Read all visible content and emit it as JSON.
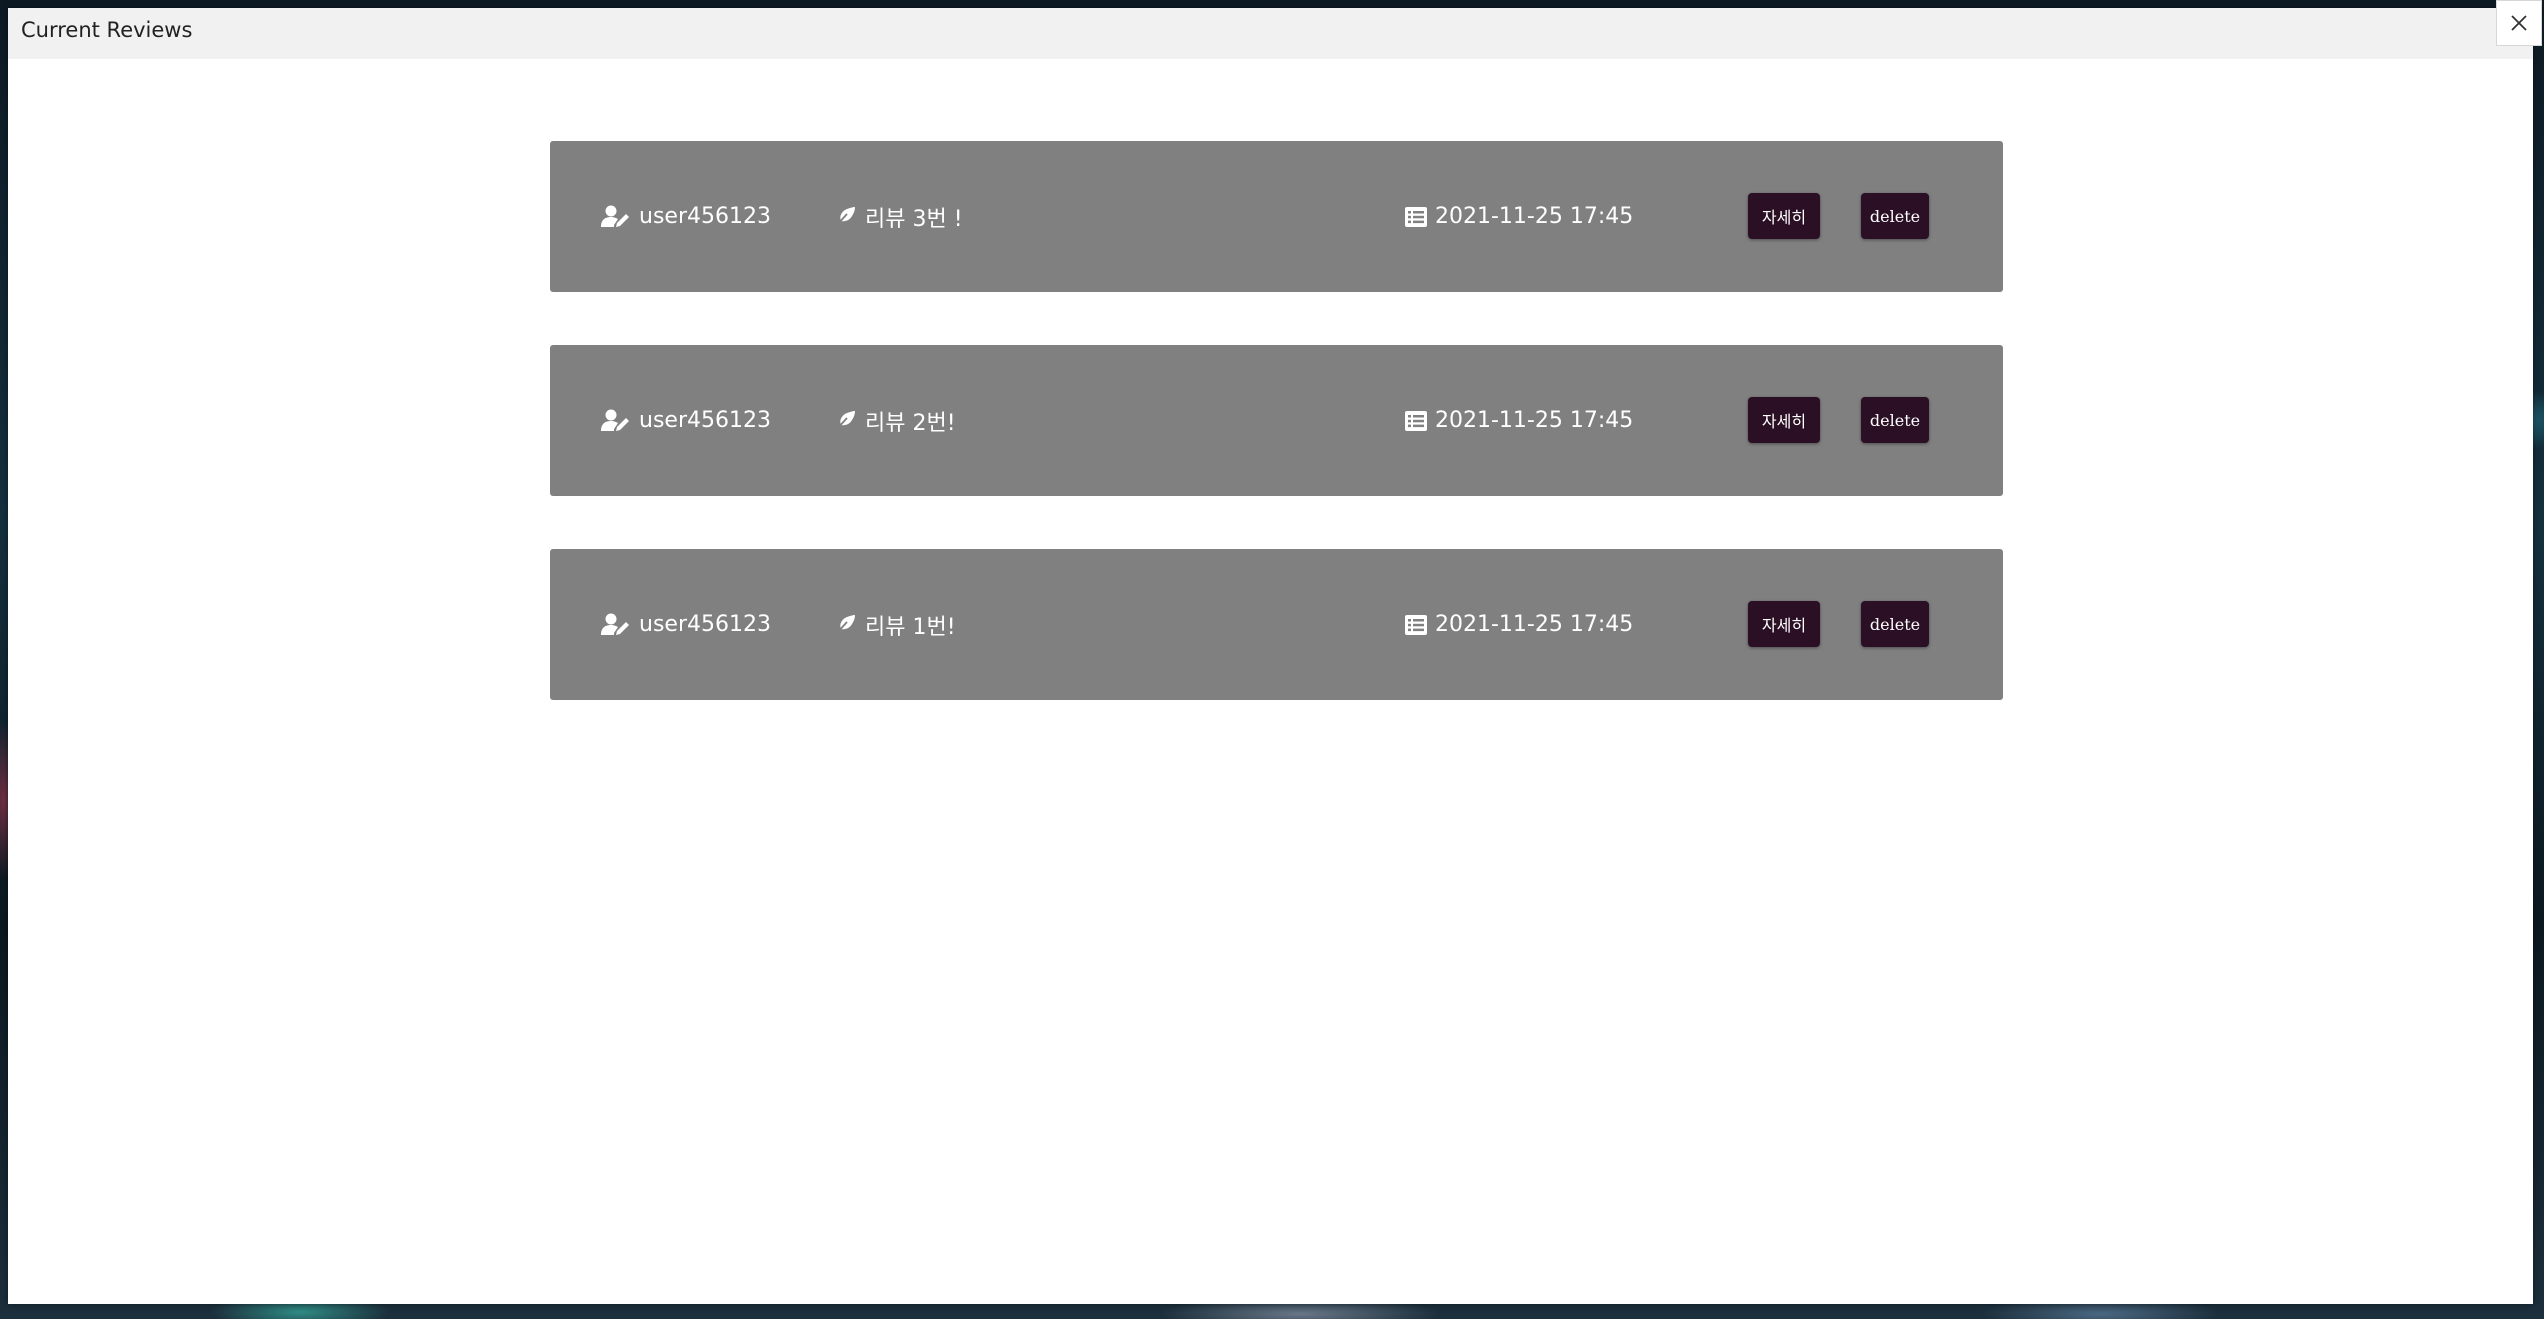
{
  "modal": {
    "title": "Current Reviews",
    "close_icon": "close-icon"
  },
  "reviews": [
    {
      "user": "user456123",
      "title": "리뷰 3번 !",
      "date": "2021-11-25 17:45",
      "detail_label": "자세히",
      "delete_label": "delete"
    },
    {
      "user": "user456123",
      "title": "리뷰 2번!",
      "date": "2021-11-25 17:45",
      "detail_label": "자세히",
      "delete_label": "delete"
    },
    {
      "user": "user456123",
      "title": "리뷰 1번!",
      "date": "2021-11-25 17:45",
      "detail_label": "자세히",
      "delete_label": "delete"
    }
  ],
  "icons": {
    "user": "user-pen-icon",
    "title": "feather-pen-icon",
    "date": "list-alt-icon"
  },
  "colors": {
    "card_bg": "#808080",
    "button_bg": "#2b0f24",
    "header_bg": "#f1f1f1"
  }
}
